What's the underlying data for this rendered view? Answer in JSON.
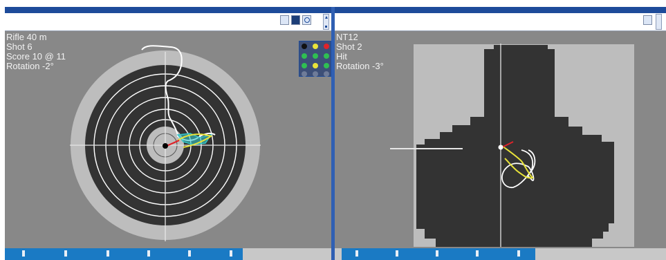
{
  "left_window": {
    "title": "",
    "info_line1": "",
    "info_line2": "",
    "overlay": {
      "line1": "Rifle 40 m",
      "line2": "Shot 6",
      "line3": "Score 10 @ 11",
      "line4": "Rotation -2°"
    },
    "status_segments": 6
  },
  "right_window": {
    "title": "",
    "info_line1": "",
    "info_line2": "",
    "overlay": {
      "line1": "NT12",
      "line2": "Shot 2",
      "line3": "Hit",
      "line4": "Rotation -3°"
    },
    "status_segments": 5
  },
  "colors": {
    "background": "#888888",
    "target_dark": "#333333",
    "target_light": "#b9b9b9",
    "trace_white": "#ffffff",
    "trace_yellow": "#e8e33a",
    "trace_cyan": "#36c6c8",
    "trace_red": "#e0232a",
    "title_bar": "#1d4b9a",
    "status_blue": "#1a7ac4"
  },
  "icons": [
    "window-mode-icon",
    "target-icon",
    "settings-ring-icon",
    "scroll-up-icon",
    "scroll-down-icon"
  ]
}
